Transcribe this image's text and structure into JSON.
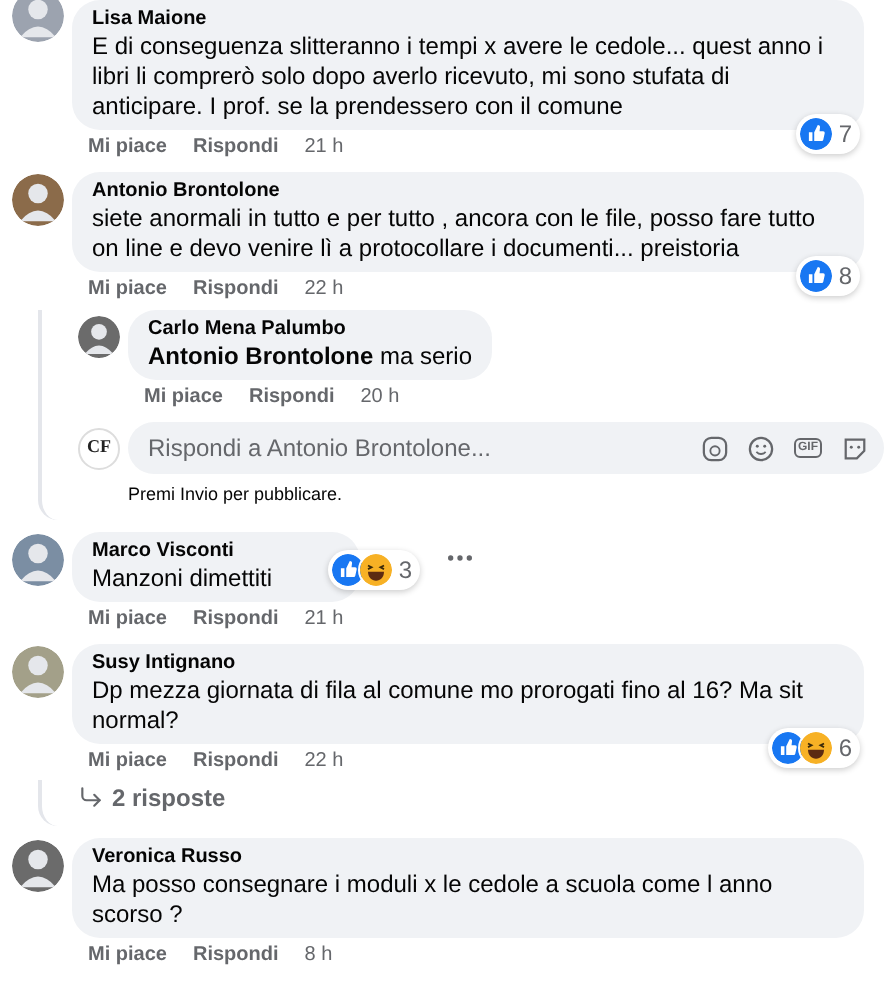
{
  "comments": [
    {
      "author": "Lisa Maione",
      "text": "E di conseguenza slitteranno i tempi x avere le cedole... quest anno i libri li comprerò solo dopo averlo ricevuto, mi sono stufata di anticipare. I prof. se la prendessero con il comune",
      "reactions": {
        "icons": [
          {
            "kind": "like"
          }
        ],
        "count": "7"
      },
      "like": "Mi piace",
      "reply": "Rispondi",
      "time": "21 h"
    },
    {
      "author": "Antonio Brontolone",
      "text": "siete anormali in tutto e per tutto , ancora con le file, posso fare tutto on line e devo venire lì a protocollare i documenti... preistoria",
      "reactions": {
        "icons": [
          {
            "kind": "like"
          }
        ],
        "count": "8"
      },
      "like": "Mi piace",
      "reply": "Rispondi",
      "time": "22 h",
      "replies": [
        {
          "author": "Carlo Mena Palumbo",
          "text": "**Antonio Brontolone** ma serio",
          "like": "Mi piace",
          "reply": "Rispondi",
          "time": "20 h"
        }
      ],
      "reply_box": {
        "avatar_text": "CF",
        "placeholder": "Rispondi a Antonio Brontolone...",
        "gif_label": "GIF",
        "hint": "Premi Invio per pubblicare."
      }
    },
    {
      "author": "Marco Visconti",
      "text": "Manzoni dimettiti",
      "reactions": {
        "icons": [
          {
            "kind": "like"
          },
          {
            "kind": "haha"
          }
        ],
        "count": "3"
      },
      "like": "Mi piace",
      "reply": "Rispondi",
      "time": "21 h"
    },
    {
      "author": "Susy Intignano",
      "text": "Dp mezza giornata di fila al comune mo prorogati fino al 16? Ma sit normal?",
      "reactions": {
        "icons": [
          {
            "kind": "like"
          },
          {
            "kind": "haha"
          }
        ],
        "count": "6"
      },
      "like": "Mi piace",
      "reply": "Rispondi",
      "time": "22 h",
      "more_replies": "2 risposte"
    },
    {
      "author": "Veronica Russo",
      "text": "Ma posso consegnare i moduli x le cedole a scuola come l anno scorso ?",
      "like": "Mi piace",
      "reply": "Rispondi",
      "time": "8 h"
    }
  ]
}
